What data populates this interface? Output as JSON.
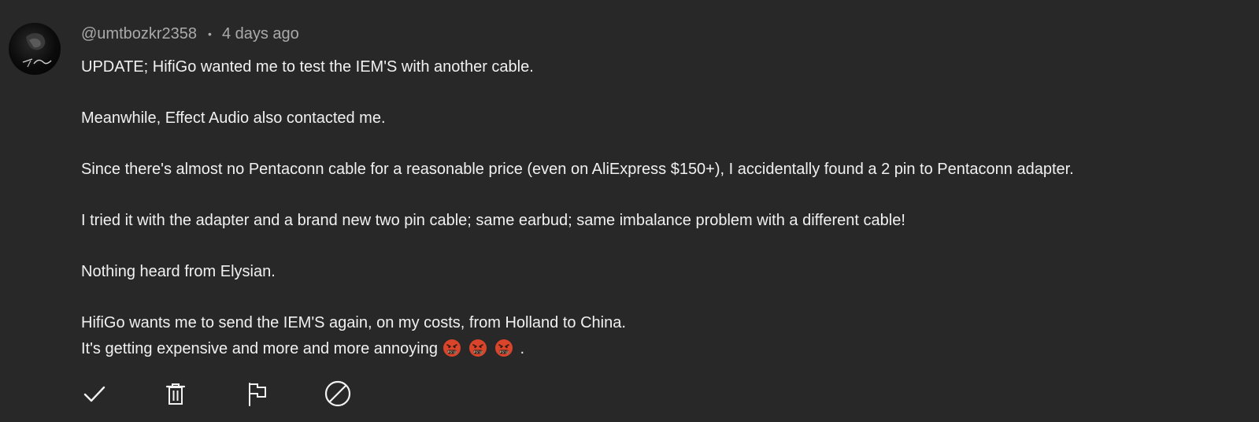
{
  "comment": {
    "author": "@umtbozkr2358",
    "separator": "•",
    "time": "4 days ago",
    "lines": {
      "l0": "UPDATE; HifiGo wanted me to test the IEM'S with another cable.",
      "l1": "Meanwhile, Effect Audio also contacted me.",
      "l2": "Since there's almost no Pentaconn cable for a reasonable price (even on AliExpress $150+), I accidentally found a 2 pin to Pentaconn adapter.",
      "l3": "I tried it with the adapter and a brand new two pin cable; same earbud; same imbalance problem with a different cable!",
      "l4": "Nothing heard from Elysian.",
      "l5": "HifiGo wants me to send the IEM'S again, on my costs, from Holland to China.",
      "l6": "It's getting expensive and more and more annoying ",
      "l6_end": "."
    },
    "emojis": [
      "face-with-symbols-on-mouth",
      "face-with-symbols-on-mouth",
      "face-with-symbols-on-mouth"
    ]
  },
  "actions": [
    {
      "name": "approve",
      "icon": "checkmark-icon"
    },
    {
      "name": "delete",
      "icon": "trash-icon"
    },
    {
      "name": "report",
      "icon": "flag-icon"
    },
    {
      "name": "block",
      "icon": "block-icon"
    }
  ],
  "colors": {
    "background": "#282828",
    "text": "#f1f1f1",
    "meta": "#aaaaaa",
    "emoji": "#d9442a"
  }
}
